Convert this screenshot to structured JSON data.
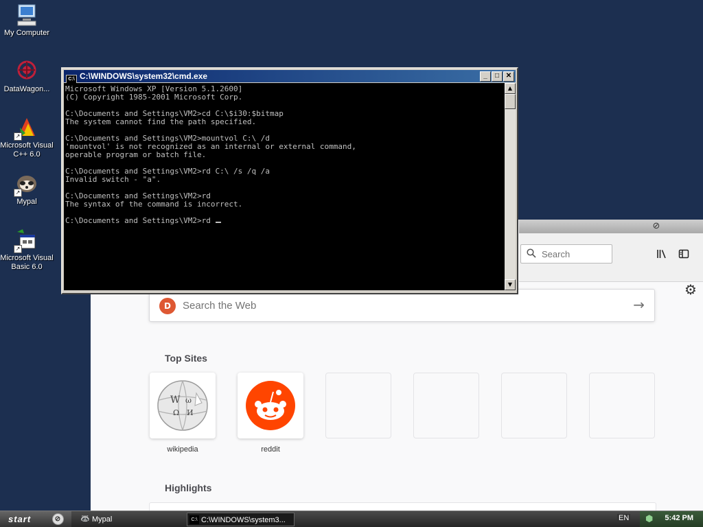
{
  "desktop": {
    "icons": [
      {
        "label": "My Computer",
        "icon": "computer-icon"
      },
      {
        "label": "DataWagon...",
        "icon": "datawagon-icon"
      },
      {
        "label": "Microsoft Visual C++ 6.0",
        "icon": "visual-cpp-icon"
      },
      {
        "label": "Mypal",
        "icon": "mypal-icon"
      },
      {
        "label": "Microsoft Visual Basic 6.0",
        "icon": "visual-basic-icon"
      }
    ]
  },
  "cmd": {
    "title": "C:\\WINDOWS\\system32\\cmd.exe",
    "lines": [
      "Microsoft Windows XP [Version 5.1.2600]",
      "(C) Copyright 1985-2001 Microsoft Corp.",
      "",
      "C:\\Documents and Settings\\VM2>cd C:\\$i30:$bitmap",
      "The system cannot find the path specified.",
      "",
      "C:\\Documents and Settings\\VM2>mountvol C:\\ /d",
      "'mountvol' is not recognized as an internal or external command,",
      "operable program or batch file.",
      "",
      "C:\\Documents and Settings\\VM2>rd C:\\ /s /q /a",
      "Invalid switch - \"a\".",
      "",
      "C:\\Documents and Settings\\VM2>rd",
      "The syntax of the command is incorrect.",
      ""
    ],
    "prompt": "C:\\Documents and Settings\\VM2>rd "
  },
  "browser": {
    "search_placeholder": "Search",
    "web_search_placeholder": "Search the Web",
    "top_sites_title": "Top Sites",
    "highlights_title": "Highlights",
    "top_sites": [
      {
        "label": "wikipedia"
      },
      {
        "label": "reddit"
      }
    ]
  },
  "taskbar": {
    "start_label": "start",
    "tasks": [
      {
        "label": "Mypal"
      },
      {
        "label": "C:\\WINDOWS\\system3..."
      }
    ],
    "language": "EN",
    "clock": "5:42 PM"
  }
}
